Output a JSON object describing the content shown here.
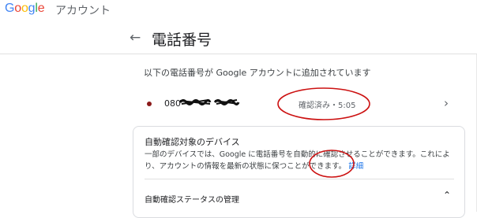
{
  "header": {
    "logo_letters": [
      {
        "ch": "G",
        "color": "#4285F4"
      },
      {
        "ch": "o",
        "color": "#EA4335"
      },
      {
        "ch": "o",
        "color": "#FBBC05"
      },
      {
        "ch": "g",
        "color": "#4285F4"
      },
      {
        "ch": "l",
        "color": "#34A853"
      },
      {
        "ch": "e",
        "color": "#EA4335"
      }
    ],
    "product": "アカウント"
  },
  "page": {
    "back_icon": "arrow-left-icon",
    "title": "電話番号"
  },
  "intro": "以下の電話番号が Google アカウントに追加されています",
  "phone": {
    "number_visible": "080",
    "status": "確認済み・5:05",
    "dot_color": "#8b1a1a",
    "chevron_icon": "chevron-right-icon"
  },
  "auto_verify": {
    "title": "自動確認対象のデバイス",
    "desc": "一部のデバイスでは、Google に電話番号を自動的に確認させることができます。これにより、アカウントの情報を最新の状態に保つことができます。",
    "link": "詳細",
    "section": "自動確認ステータスの管理",
    "chevron_icon": "chevron-up-icon"
  },
  "annotation_color": "#cc1111"
}
